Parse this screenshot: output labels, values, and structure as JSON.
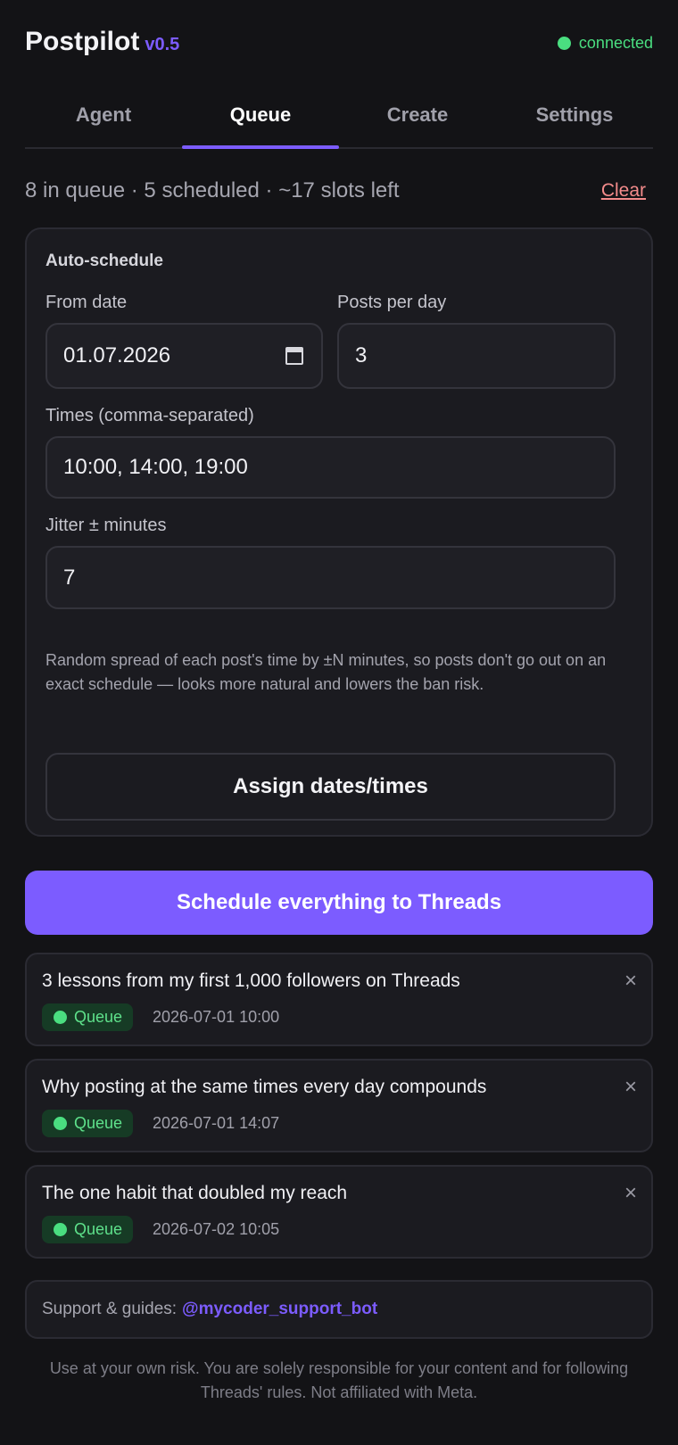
{
  "app": {
    "name": "Postpilot",
    "version": "v0.5",
    "status": "connected"
  },
  "tabs": [
    {
      "label": "Agent",
      "active": false
    },
    {
      "label": "Queue",
      "active": true
    },
    {
      "label": "Create",
      "active": false
    },
    {
      "label": "Settings",
      "active": false
    }
  ],
  "summary": {
    "text": "8 in queue · 5 scheduled · ~17 slots left",
    "clear_label": "Clear"
  },
  "auto_schedule": {
    "title": "Auto-schedule",
    "from_date_label": "From date",
    "from_date_value": "01.07.2026",
    "posts_per_day_label": "Posts per day",
    "posts_per_day_value": "3",
    "times_label": "Times (comma-separated)",
    "times_value": "10:00, 14:00, 19:00",
    "jitter_label": "Jitter ± minutes",
    "jitter_value": "7",
    "hint": "Random spread of each post's time by ±N minutes, so posts don't go out on an exact schedule — looks more natural and lowers the ban risk.",
    "assign_label": "Assign dates/times"
  },
  "schedule_all_label": "Schedule everything to Threads",
  "queue": [
    {
      "title": "3 lessons from my first 1,000 followers on Threads",
      "status": "Queue",
      "time": "2026-07-01 10:00"
    },
    {
      "title": "Why posting at the same times every day compounds",
      "status": "Queue",
      "time": "2026-07-01 14:07"
    },
    {
      "title": "The one habit that doubled my reach",
      "status": "Queue",
      "time": "2026-07-02 10:05"
    }
  ],
  "close_glyph": "×",
  "support": {
    "label": "Support & guides:",
    "link": "@mycoder_support_bot"
  },
  "disclaimer": "Use at your own risk. You are solely responsible for your content and for following Threads' rules. Not affiliated with Meta.",
  "colors": {
    "accent": "#7c5cff",
    "connected": "#4ade80",
    "danger_link": "#f38b8b",
    "background": "#131316"
  },
  "icons": {
    "calendar": "calendar-icon",
    "close": "close-icon",
    "status_dot": "status-dot-icon"
  }
}
